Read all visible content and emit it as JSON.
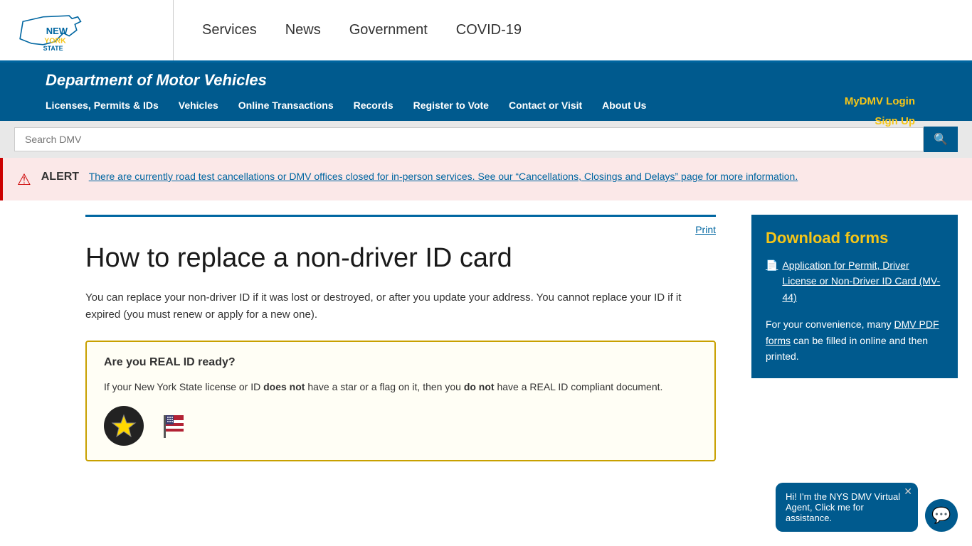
{
  "topnav": {
    "logo_alt": "New York State",
    "links": [
      {
        "label": "Services",
        "name": "services"
      },
      {
        "label": "News",
        "name": "news"
      },
      {
        "label": "Government",
        "name": "government"
      },
      {
        "label": "COVID-19",
        "name": "covid19"
      }
    ]
  },
  "dmv": {
    "title": "Department of Motor Vehicles",
    "nav": [
      {
        "label": "Licenses, Permits & IDs",
        "name": "licenses"
      },
      {
        "label": "Vehicles",
        "name": "vehicles"
      },
      {
        "label": "Online Transactions",
        "name": "online-transactions"
      },
      {
        "label": "Records",
        "name": "records"
      },
      {
        "label": "Register to Vote",
        "name": "register-to-vote"
      },
      {
        "label": "Contact or Visit",
        "name": "contact"
      },
      {
        "label": "About Us",
        "name": "about-us"
      }
    ],
    "mydmv_login": "MyDMV Login",
    "sign_up": "Sign Up"
  },
  "search": {
    "placeholder": "Search DMV"
  },
  "alert": {
    "label": "ALERT",
    "text": "There are currently road test cancellations or DMV offices closed for in-person services. See our “Cancellations, Closings and Delays” page for more information."
  },
  "page": {
    "print": "Print",
    "title": "How to replace a non-driver ID card",
    "intro": "You can replace your non-driver ID if it was lost or destroyed, or after you update your address. You cannot replace your ID if it expired (you must renew or apply for a new one).",
    "real_id": {
      "title": "Are you REAL ID ready?",
      "text_part1": "If your New York State license or ID ",
      "text_bold1": "does not",
      "text_part2": " have a star or a flag on it, then you ",
      "text_bold2": "do not",
      "text_part3": " have a REAL ID compliant document."
    }
  },
  "sidebar": {
    "download_forms_title": "Download forms",
    "form_link": "Application for Permit, Driver License or Non-Driver ID Card (MV-44)",
    "extra_text1": "For your convenience, many ",
    "extra_link": "DMV PDF forms",
    "extra_text2": " can be filled in online and then printed."
  },
  "chat": {
    "message": "Hi! I'm the NYS DMV Virtual Agent, Click me for assistance."
  }
}
